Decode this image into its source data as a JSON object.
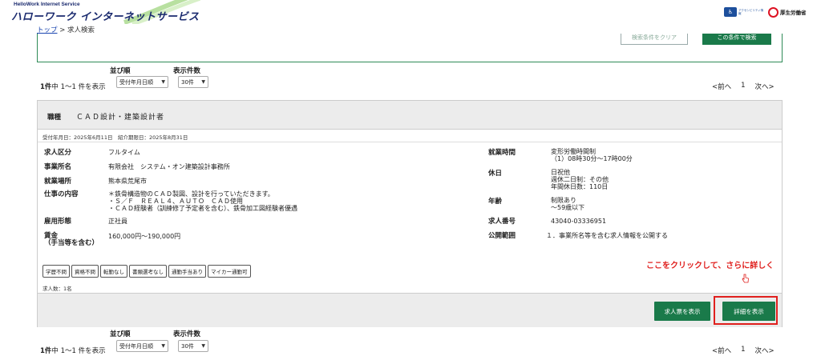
{
  "header": {
    "logo_sub": "HelloWork Internet Service",
    "logo_main": "ハローワーク インターネットサービス",
    "badge_accessibility_text": "アクセシビリティ情報",
    "badge_ministry_text": "厚生労働省"
  },
  "breadcrumb": {
    "top_link": "トップ",
    "separator": ">",
    "current": "求人検索"
  },
  "search_box": {
    "outline_button": "検索条件をクリア",
    "green_button": "この条件で検索"
  },
  "list_controls_top": {
    "sort_label": "並び順",
    "sort_value": "受付年月日順",
    "per_page_label": "表示件数",
    "per_page_value": "30件",
    "count_text_bold": "1件",
    "count_text_rest": "中 1〜1 件を表示",
    "pager_prev": "<前へ",
    "pager_page": "1",
    "pager_next": "次へ>"
  },
  "list_controls_bottom": {
    "sort_label": "並び順",
    "sort_value": "受付年月日順",
    "per_page_label": "表示件数",
    "per_page_value": "30件",
    "count_text_bold": "1件",
    "count_text_rest": "中 1〜1 件を表示",
    "pager_prev": "<前へ",
    "pager_page": "1",
    "pager_next": "次へ>"
  },
  "job": {
    "occupation_label": "職種",
    "occupation_value": "ＣＡＤ設計・建築設計者",
    "dates_text": "受付年月日：2025年6月11日　紹介期限日：2025年8月31日",
    "left": {
      "kyujin_kubun_label": "求人区分",
      "kyujin_kubun_value": "フルタイム",
      "company_label": "事業所名",
      "company_value": "有限会社　システム・オン建築設計事務所",
      "location_label": "就業場所",
      "location_value": "熊本県荒尾市",
      "job_content_label": "仕事の内容",
      "job_content_lines": [
        "＊鉄骨構造物のＣＡＤ製図、設計を行っていただきます。",
        "・Ｓ／Ｆ　ＲＥＡＬ４、ＡＵＴＯ　ＣＡＤ使用",
        "・ＣＡＤ経験者（訓練修了予定者を含む）、鉄骨加工図経験者優遇"
      ],
      "employment_label": "雇用形態",
      "employment_value": "正社員",
      "wage_label_1": "賃金",
      "wage_label_2": "（手当等を含む）",
      "wage_value": "160,000円〜190,000円"
    },
    "right": {
      "work_hours_label": "就業時間",
      "work_hours_lines": [
        "変形労働時間制",
        "（1）08時30分〜17時00分"
      ],
      "holidays_label": "休日",
      "holidays_lines": [
        "日祝他",
        "週休二日制：その他",
        "年間休日数：110日"
      ],
      "age_label": "年齢",
      "age_lines": [
        "制限あり",
        "〜59歳以下"
      ],
      "job_number_label": "求人番号",
      "job_number_value": "43040-03336951",
      "disclosure_label": "公開範囲",
      "disclosure_value": "１．事業所名等を含む求人情報を公開する"
    },
    "tags": [
      "学歴不問",
      "資格不問",
      "転勤なし",
      "書類選考なし",
      "通勤手当あり",
      "マイカー通勤可"
    ],
    "hires_text": "求人数：1名",
    "btn_kyujinhyo": "求人票を表示",
    "btn_detail": "詳細を表示"
  },
  "annotation": {
    "text": "ここをクリックして、さらに詳しく"
  },
  "colors": {
    "brand_green": "#1a7a4a",
    "annotation_red": "#e0201e",
    "link_blue": "#1a45b0",
    "card_gray": "#ececec"
  }
}
